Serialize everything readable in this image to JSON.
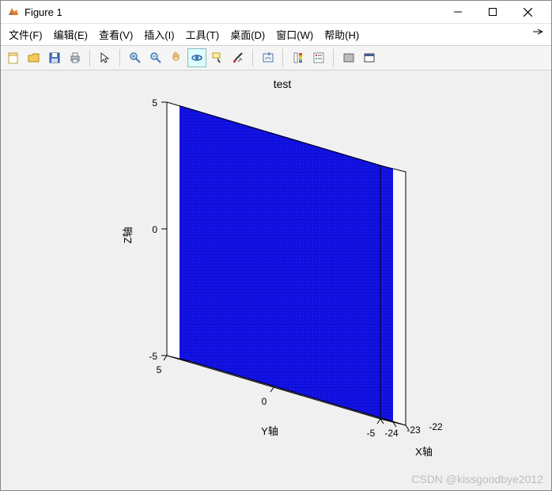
{
  "window": {
    "title": "Figure 1"
  },
  "menubar": {
    "items": [
      "文件(F)",
      "编辑(E)",
      "查看(V)",
      "插入(I)",
      "工具(T)",
      "桌面(D)",
      "窗口(W)",
      "帮助(H)"
    ]
  },
  "toolbar": {
    "icons": [
      "new-figure-icon",
      "open-icon",
      "save-icon",
      "print-icon",
      "pointer-icon",
      "zoom-in-icon",
      "zoom-out-icon",
      "pan-icon",
      "rotate-3d-icon",
      "data-cursor-icon",
      "brush-icon",
      "link-icon",
      "colorbar-icon",
      "legend-icon",
      "hide-tools-icon",
      "dock-icon"
    ],
    "selected_index": 8
  },
  "chart_data": {
    "type": "area",
    "title": "test",
    "xlabel": "X轴",
    "ylabel": "Y轴",
    "zlabel": "Z轴",
    "x_ticks": [
      -24,
      -23,
      -22
    ],
    "y_ticks": [
      -5,
      0,
      5
    ],
    "z_ticks": [
      -5,
      0,
      5
    ],
    "xlim": [
      -24,
      -22
    ],
    "ylim": [
      -5,
      5
    ],
    "zlim": [
      -5,
      5
    ],
    "surface": {
      "description": "Dense blue mesh surface at approximately constant X ≈ -23, spanning full Y [-5,5] and Z [-5,5]",
      "grid_density": "high",
      "color": "#0000ff"
    }
  },
  "watermark": "CSDN @kissgoodbye2012"
}
